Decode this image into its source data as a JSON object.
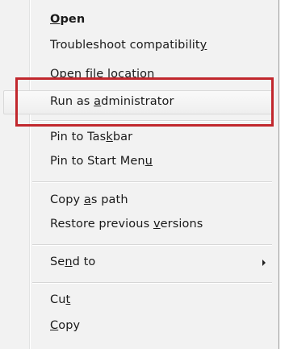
{
  "menu": {
    "items": [
      {
        "pre": "",
        "u": "O",
        "post": "pen"
      },
      {
        "pre": "Troubleshoot compatibilit",
        "u": "y",
        "post": ""
      },
      {
        "pre": "Open file loca",
        "u": "t",
        "post": "ion"
      },
      {
        "pre": "Run as ",
        "u": "a",
        "post": "dministrator"
      },
      {
        "pre": "Pin to Tas",
        "u": "k",
        "post": "bar"
      },
      {
        "pre": "Pin to Start Men",
        "u": "u",
        "post": ""
      },
      {
        "pre": "Copy ",
        "u": "a",
        "post": "s path"
      },
      {
        "pre": "Restore previous ",
        "u": "v",
        "post": "ersions"
      },
      {
        "pre": "Se",
        "u": "n",
        "post": "d to"
      },
      {
        "pre": "Cu",
        "u": "t",
        "post": ""
      },
      {
        "pre": "",
        "u": "C",
        "post": "opy"
      }
    ]
  },
  "colors": {
    "annotation_red": "#c1272d",
    "menu_background": "#f2f2f2"
  },
  "icons": {
    "submenu": "submenu-arrow-icon"
  }
}
